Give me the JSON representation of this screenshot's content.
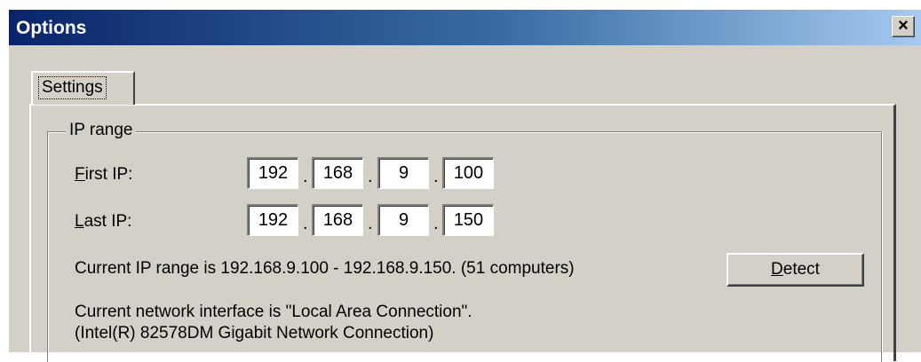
{
  "window": {
    "title": "Options",
    "close_glyph": "×",
    "close_icon": "close-icon"
  },
  "tabs": [
    {
      "label": "Settings",
      "selected": true
    }
  ],
  "ip_range": {
    "group_label": "IP range",
    "first_ip_label": "First IP:",
    "last_ip_label": "Last IP:",
    "first_ip": [
      "192",
      "168",
      "9",
      "100"
    ],
    "last_ip": [
      "192",
      "168",
      "9",
      "150"
    ],
    "separator": ".",
    "current_range_text": "Current IP range is 192.168.9.100 - 192.168.9.150. (51 computers)",
    "detect_label": "Detect",
    "interface_text_line1": "Current network interface is \"Local Area Connection\".",
    "interface_text_line2": "(Intel(R) 82578DM Gigabit Network Connection)"
  },
  "colors": {
    "title_gradient_start": "#0a246a",
    "title_gradient_end": "#a6caf0",
    "face": "#d4d0c8"
  }
}
